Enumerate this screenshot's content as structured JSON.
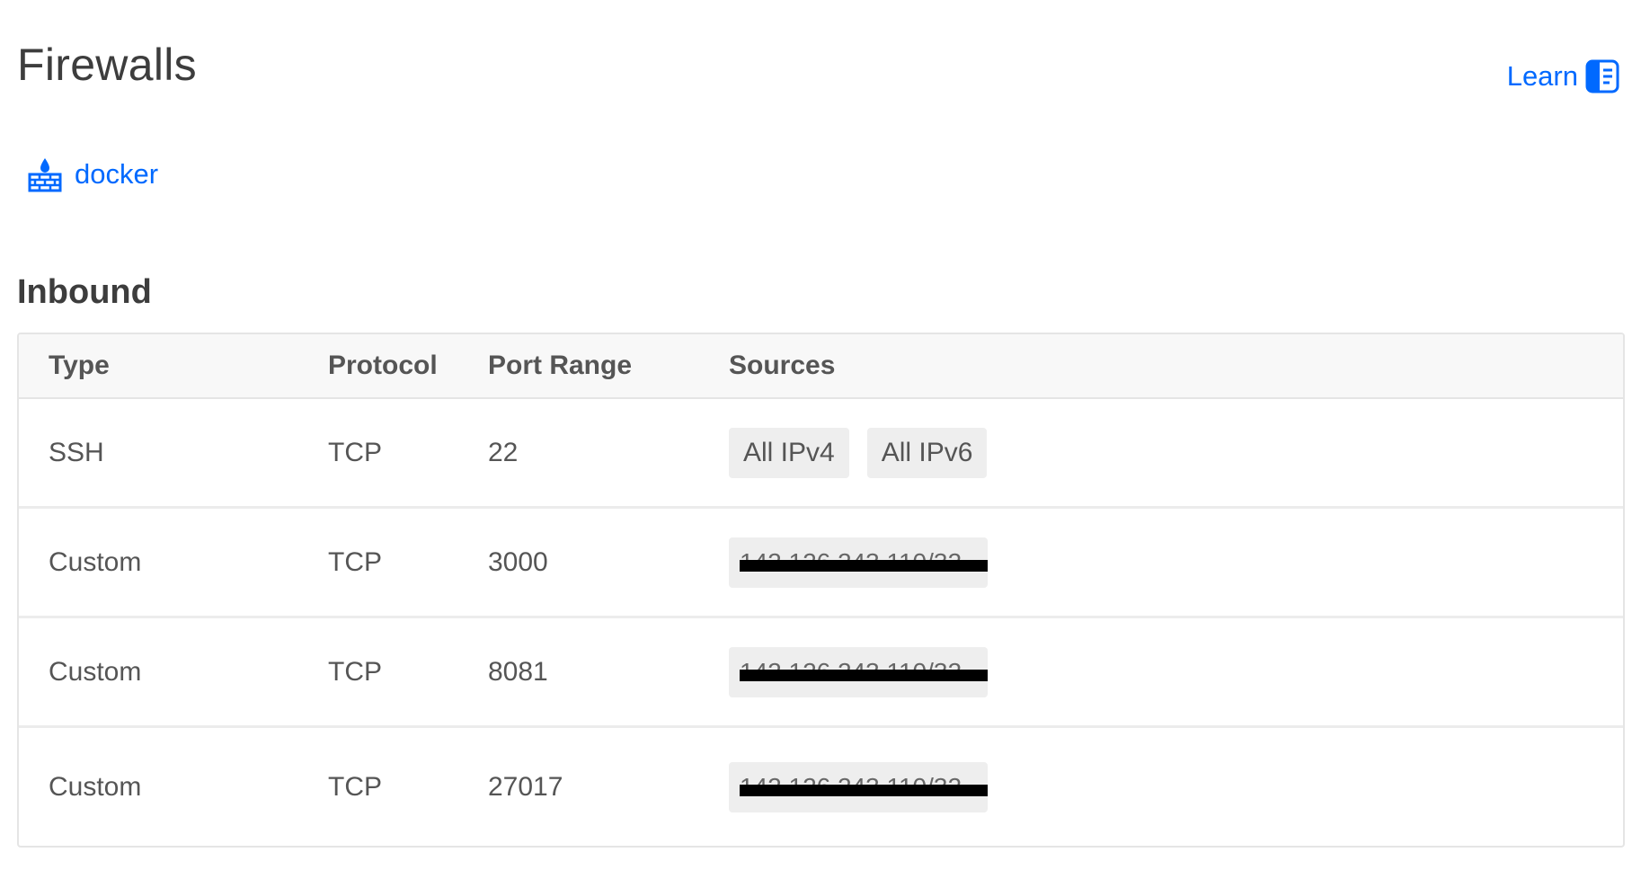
{
  "header": {
    "title": "Firewalls",
    "learn_label": "Learn"
  },
  "firewall": {
    "name": "docker"
  },
  "inbound": {
    "section_title": "Inbound",
    "columns": [
      "Type",
      "Protocol",
      "Port Range",
      "Sources"
    ],
    "rows": [
      {
        "type": "SSH",
        "protocol": "TCP",
        "port_range": "22",
        "sources": [
          "All IPv4",
          "All IPv6"
        ]
      },
      {
        "type": "Custom",
        "protocol": "TCP",
        "port_range": "3000",
        "sources": [
          "142.126.243.110/32"
        ]
      },
      {
        "type": "Custom",
        "protocol": "TCP",
        "port_range": "8081",
        "sources": [
          "142.126.243.110/32"
        ]
      },
      {
        "type": "Custom",
        "protocol": "TCP",
        "port_range": "27017",
        "sources": [
          "142.126.243.110/32"
        ]
      }
    ]
  },
  "colors": {
    "link": "#0069ff",
    "heading": "#3d3d3d",
    "text": "#555555",
    "chip_bg": "#eeeeee",
    "table_header_bg": "#f8f8f8",
    "border": "#e5e5e5"
  }
}
